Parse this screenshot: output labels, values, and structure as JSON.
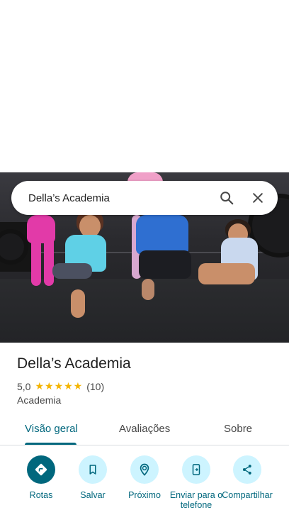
{
  "search": {
    "query": "Della’s Academia"
  },
  "icons": {
    "search": "search-icon",
    "close": "close-icon"
  },
  "place": {
    "name": "Della’s Academia",
    "rating": "5,0",
    "stars": "★★★★★",
    "reviews": "(10)",
    "category": "Academia"
  },
  "tabs": [
    {
      "label": "Visão geral",
      "active": true
    },
    {
      "label": "Avaliações",
      "active": false
    },
    {
      "label": "Sobre",
      "active": false
    }
  ],
  "actions": [
    {
      "label": "Rotas",
      "icon": "directions-icon"
    },
    {
      "label": "Salvar",
      "icon": "bookmark-icon"
    },
    {
      "label": "Próximo",
      "icon": "nearby-icon"
    },
    {
      "label": "Enviar para o telefone",
      "icon": "send-to-phone-icon"
    },
    {
      "label": "Compartilhar",
      "icon": "share-icon"
    }
  ],
  "colors": {
    "accent": "#00677d",
    "accent_light": "#cdf4ff",
    "star": "#f4b400"
  }
}
